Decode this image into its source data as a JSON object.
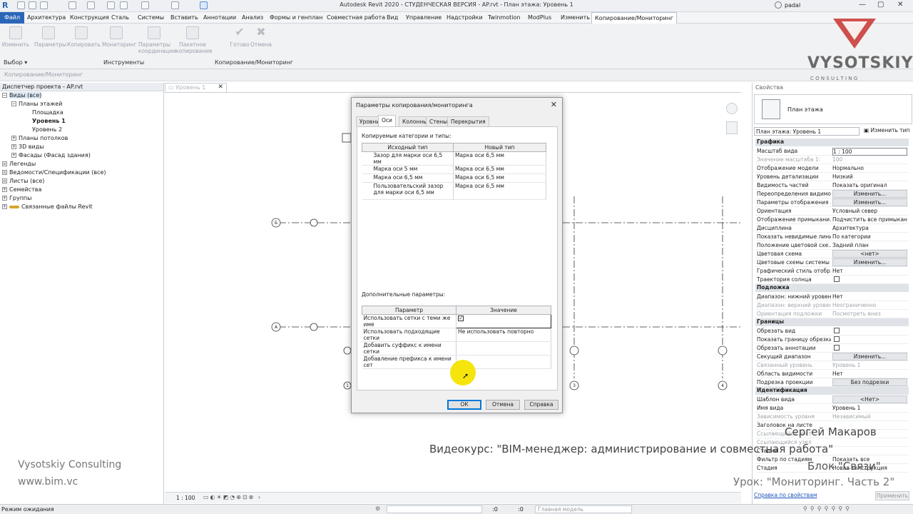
{
  "titlebar": {
    "title": "Autodesk Revit 2020 - СТУДЕНЧЕСКАЯ ВЕРСИЯ - AP.rvt - План этажа: Уровень 1",
    "user": "padal"
  },
  "menu": {
    "items": [
      "Файл",
      "Архитектура",
      "Конструкция",
      "Сталь",
      "Системы",
      "Вставить",
      "Аннотации",
      "Анализ",
      "Формы и генплан",
      "Совместная работа",
      "Вид",
      "Управление",
      "Надстройки",
      "Twinmotion",
      "ModPlus",
      "Изменить",
      "Копирование/Мониторинг"
    ]
  },
  "ribbon": {
    "buttons": [
      "Изменить",
      "Параметры",
      "Копировать",
      "Мониторинг",
      "Параметры координации",
      "Пакетное копирование",
      "Готово",
      "Отмена"
    ],
    "groups": [
      "Выбор ▾",
      "Инструменты",
      "Копирование/Мониторинг"
    ],
    "panel_label": "Копирование/Мониторинг"
  },
  "browser": {
    "header": "Диспетчер проекта - AP.rvt",
    "items": [
      "Виды (все)",
      "Планы этажей",
      "Площадка",
      "Уровень 1",
      "Уровень 2",
      "Планы потолков",
      "3D виды",
      "Фасады (Фасад здания)",
      "Легенды",
      "Ведомости/Спецификации (все)",
      "Листы (все)",
      "Семейства",
      "Группы",
      "Связанные файлы Revit"
    ]
  },
  "doctab": {
    "label": "Уровень 1"
  },
  "canvas": {
    "grid_bubbles": [
      "Б",
      "1",
      "A",
      "1",
      "3",
      "4",
      "1"
    ]
  },
  "dialog": {
    "title": "Параметры копирования/мониторинга",
    "tabs": [
      "Уровни",
      "Оси",
      "Колонны",
      "Стены",
      "Перекрытия"
    ],
    "copied_label": "Копируемые категории и типы:",
    "table1": {
      "headers": [
        "Исходный тип",
        "Новый тип"
      ],
      "rows": [
        [
          "Зазор для марки оси 6,5 мм",
          "Марка оси 6,5 мм"
        ],
        [
          "Марка оси 5 мм",
          "Марка оси 6,5 мм"
        ],
        [
          "Марка оси 6,5 мм",
          "Марка оси 6,5 мм"
        ],
        [
          "Пользовательский зазор для марки оси 6,5 мм",
          "Марка оси 6,5 мм"
        ]
      ]
    },
    "extra_label": "Дополнительные параметры:",
    "table2": {
      "headers": [
        "Параметр",
        "Значение"
      ],
      "rows": [
        [
          "Использовать сетки с теми же име",
          ""
        ],
        [
          "Использовать подходящие сетки",
          "Не использовать повторно"
        ],
        [
          "Добавить суффикс к имени сетки",
          ""
        ],
        [
          "Добавление префикса к имени сет",
          ""
        ]
      ]
    },
    "buttons": {
      "ok": "ОК",
      "cancel": "Отмена",
      "help": "Справка"
    }
  },
  "properties": {
    "header": "Свойства",
    "type_name": "План этажа",
    "selector": "План этажа: Уровень 1",
    "edit_type": "Изменить тип",
    "sections": {
      "graphics": "Графика",
      "underlay": "Подложка",
      "extents": "Границы",
      "identity": "Идентификация"
    },
    "graphics": [
      [
        "Масштаб вида",
        "1 : 100"
      ],
      [
        "Значение масштаба    1:",
        "100"
      ],
      [
        "Отображение модели",
        "Нормально"
      ],
      [
        "Уровень детализации",
        "Низкий"
      ],
      [
        "Видимость частей",
        "Показать оригинал"
      ],
      [
        "Переопределения видимо...",
        "Изменить..."
      ],
      [
        "Параметры отображения ...",
        "Изменить..."
      ],
      [
        "Ориентация",
        "Условный север"
      ],
      [
        "Отображение примыкани...",
        "Подчистить все примыкан..."
      ],
      [
        "Дисциплина",
        "Архитектура"
      ],
      [
        "Показать невидимые линии",
        "По категории"
      ],
      [
        "Положение цветовой схе...",
        "Задний план"
      ],
      [
        "Цветовая схема",
        "<нет>"
      ],
      [
        "Цветовые схемы системы",
        "Изменить..."
      ],
      [
        "Графический стиль отобр...",
        "Нет"
      ],
      [
        "Траектория солнца",
        ""
      ]
    ],
    "underlay": [
      [
        "Диапазон: нижний уровень",
        "Нет"
      ],
      [
        "Диапазон: верхний уровень",
        "Неограниченно"
      ],
      [
        "Ориентация подложки",
        "Посмотреть вниз"
      ]
    ],
    "extents": [
      [
        "Обрезать вид",
        ""
      ],
      [
        "Показать границу обрезки",
        ""
      ],
      [
        "Обрезать аннотации",
        ""
      ],
      [
        "Секущий диапазон",
        "Изменить..."
      ],
      [
        "Связанный уровень",
        "Уровень 1"
      ],
      [
        "Область видимости",
        "Нет"
      ],
      [
        "Подрезка проекции",
        "Без подрезки"
      ]
    ],
    "identity": [
      [
        "Шаблон вида",
        "<Нет>"
      ],
      [
        "Имя вида",
        "Уровень 1"
      ],
      [
        "Зависимость уровня",
        "Независимый"
      ],
      [
        "Заголовок на листе",
        ""
      ],
      [
        "Ссылающийся лист",
        ""
      ],
      [
        "Ссылающийся узел",
        ""
      ],
      [
        "Стадии",
        ""
      ],
      [
        "Фильтр по стадиям",
        "Показать все"
      ],
      [
        "Стадия",
        "Новая конструкция"
      ]
    ],
    "help_link": "Справка по свойствам",
    "apply": "Применить"
  },
  "viewbar": {
    "scale": "1 : 100"
  },
  "status": {
    "text": "Режим ожидания",
    "model": "Главная модель",
    "zero1": ":0",
    "zero2": ":0"
  },
  "overlay": {
    "logo": "VYSOTSKIY",
    "logo_sub": "C O N S U L T I N G",
    "author": "Сергей Макаров",
    "course": "Видеокурс: \"BIM-менеджер: администрирование и совместная работа\"",
    "block": "Блок \"Связи\"",
    "lesson": "Урок: \"Мониторинг. Часть 2\"",
    "company": "Vysotskiy Consulting",
    "website": "www.bim.vc"
  },
  "colors": {
    "accent": "#2a66b8",
    "logo_red": "#c8342f",
    "highlight": "#f5e400"
  }
}
